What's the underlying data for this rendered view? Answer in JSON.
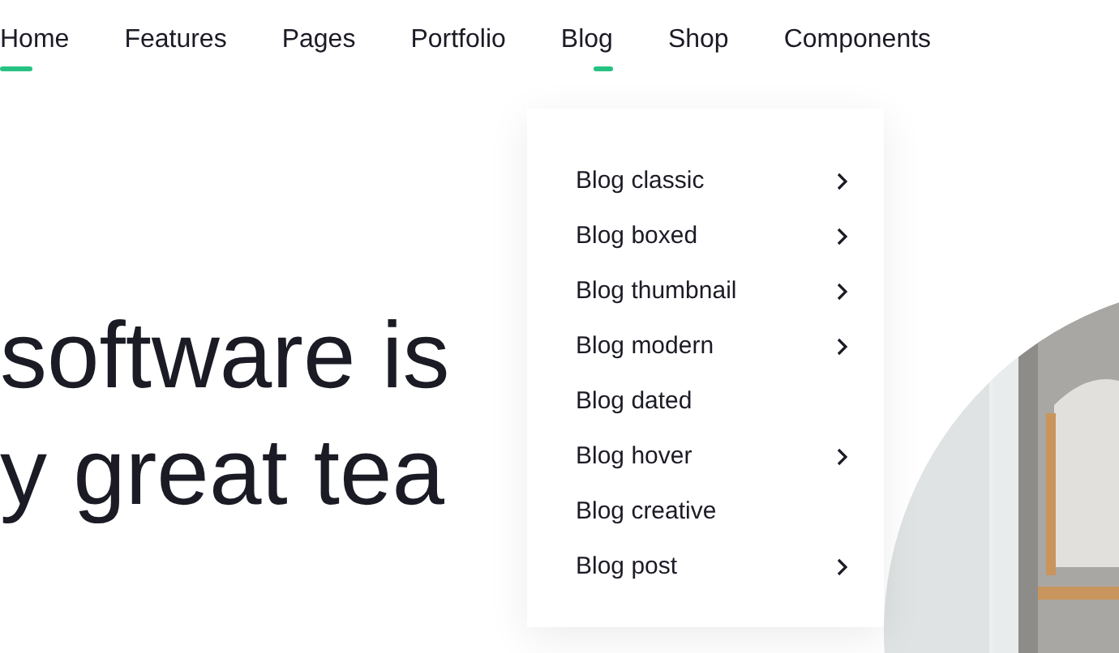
{
  "nav": [
    {
      "label": "Home",
      "selected": true,
      "open": false
    },
    {
      "label": "Features",
      "selected": false,
      "open": false
    },
    {
      "label": "Pages",
      "selected": false,
      "open": false
    },
    {
      "label": "Portfolio",
      "selected": false,
      "open": false
    },
    {
      "label": "Blog",
      "selected": false,
      "open": true
    },
    {
      "label": "Shop",
      "selected": false,
      "open": false
    },
    {
      "label": "Components",
      "selected": false,
      "open": false
    }
  ],
  "dropdown": [
    {
      "label": "Blog classic",
      "has_submenu": true
    },
    {
      "label": "Blog boxed",
      "has_submenu": true
    },
    {
      "label": "Blog thumbnail",
      "has_submenu": true
    },
    {
      "label": "Blog modern",
      "has_submenu": true
    },
    {
      "label": "Blog dated",
      "has_submenu": false
    },
    {
      "label": "Blog hover",
      "has_submenu": true
    },
    {
      "label": "Blog creative",
      "has_submenu": false
    },
    {
      "label": "Blog post",
      "has_submenu": true
    }
  ],
  "hero": {
    "heading_lines": [
      "software is",
      "y great tea"
    ]
  }
}
